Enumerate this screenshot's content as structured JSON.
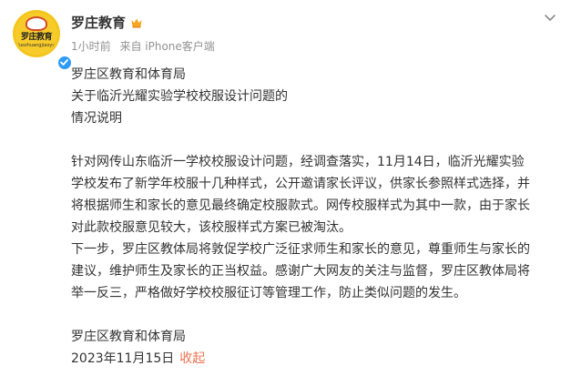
{
  "author": {
    "name": "罗庄教育",
    "avatar_text": "罗庄教育",
    "avatar_sub": "luozhuangjiaoyu",
    "time": "1小时前",
    "source": "来自 iPhone客户端"
  },
  "post": {
    "heading_lines": [
      "罗庄区教育和体育局",
      "关于临沂光耀实验学校校服设计问题的",
      "情况说明"
    ],
    "paragraph1_lines": [
      "针对网传山东临沂一学校校服设计问题，经调查落实，11月14日，临沂光耀实验",
      "学校发布了新学年校服十几种样式，公开邀请家长评议，供家长参照样式选择，并",
      "将根据师生和家长的意见最终确定校服款式。网传校服样式为其中一款，由于家长",
      "对此款校服意见较大，该校服样式方案已被淘汰。"
    ],
    "paragraph2_lines": [
      "下一步，罗庄区教体局将敦促学校广泛征求师生和家长的意见，尊重师生与家长的",
      "建议，维护师生及家长的正当权益。感谢广大网友的关注与监督，罗庄区教体局将",
      "举一反三，严格做好学校校服征订等管理工作，防止类似问题的发生。"
    ],
    "signature": "罗庄区教育和体育局",
    "date": "2023年11月15日",
    "collapse_label": "收起"
  },
  "colors": {
    "accent": "#eb7350",
    "meta": "#939393",
    "verified": "#2f9bf5",
    "avatar": "#f5c51f"
  },
  "icons": [
    "verified-badge-icon",
    "crown-icon",
    "chevron-down-icon"
  ]
}
